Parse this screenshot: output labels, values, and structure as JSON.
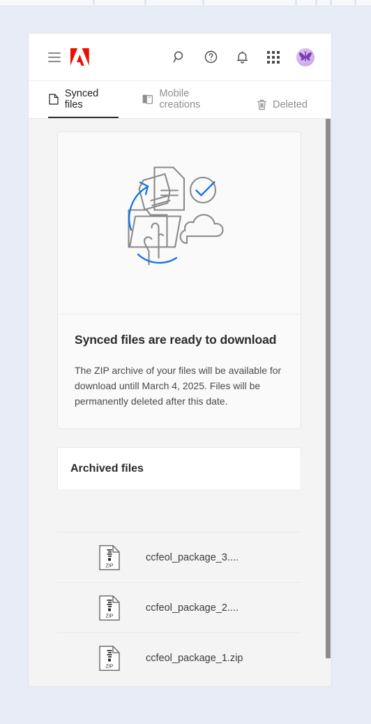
{
  "window": {
    "background_color": "#e7ecf6",
    "panel_background": "#f4f4f4"
  },
  "header": {
    "menu_icon": "hamburger-menu-icon",
    "logo": "adobe-logo",
    "logo_color": "#eb1000",
    "icons": [
      {
        "name": "search-icon",
        "label": "Search"
      },
      {
        "name": "help-icon",
        "label": "Help"
      },
      {
        "name": "notifications-bell-icon",
        "label": "Notifications"
      },
      {
        "name": "app-switcher-grid-icon",
        "label": "Apps"
      }
    ],
    "avatar": {
      "name": "user-avatar",
      "background_color": "#d0aeea",
      "glyph": "butterfly"
    }
  },
  "tabs": [
    {
      "label": "Synced files",
      "icon": "document-icon",
      "active": true
    },
    {
      "label": "Mobile creations",
      "icon": "mobile-device-icon",
      "active": false
    },
    {
      "label": "Deleted",
      "icon": "trash-can-icon",
      "active": false
    }
  ],
  "main": {
    "illustration": {
      "name": "sync-ready-illustration",
      "accent_color": "#1473e6",
      "line_color": "#8a8a8a"
    },
    "card": {
      "title": "Synced files are ready to download",
      "description": "The ZIP archive of your files will be available for download untill March 4, 2025. Files will be permanently deleted after this date."
    },
    "archived": {
      "title": "Archived files"
    },
    "files": [
      {
        "name": "ccfeol_package_3....",
        "type": "ZIP"
      },
      {
        "name": "ccfeol_package_2....",
        "type": "ZIP"
      },
      {
        "name": "ccfeol_package_1.zip",
        "type": "ZIP"
      }
    ]
  },
  "scrollbar": {
    "name": "vertical-scrollbar",
    "thumb_color": "#8c8c8c"
  }
}
